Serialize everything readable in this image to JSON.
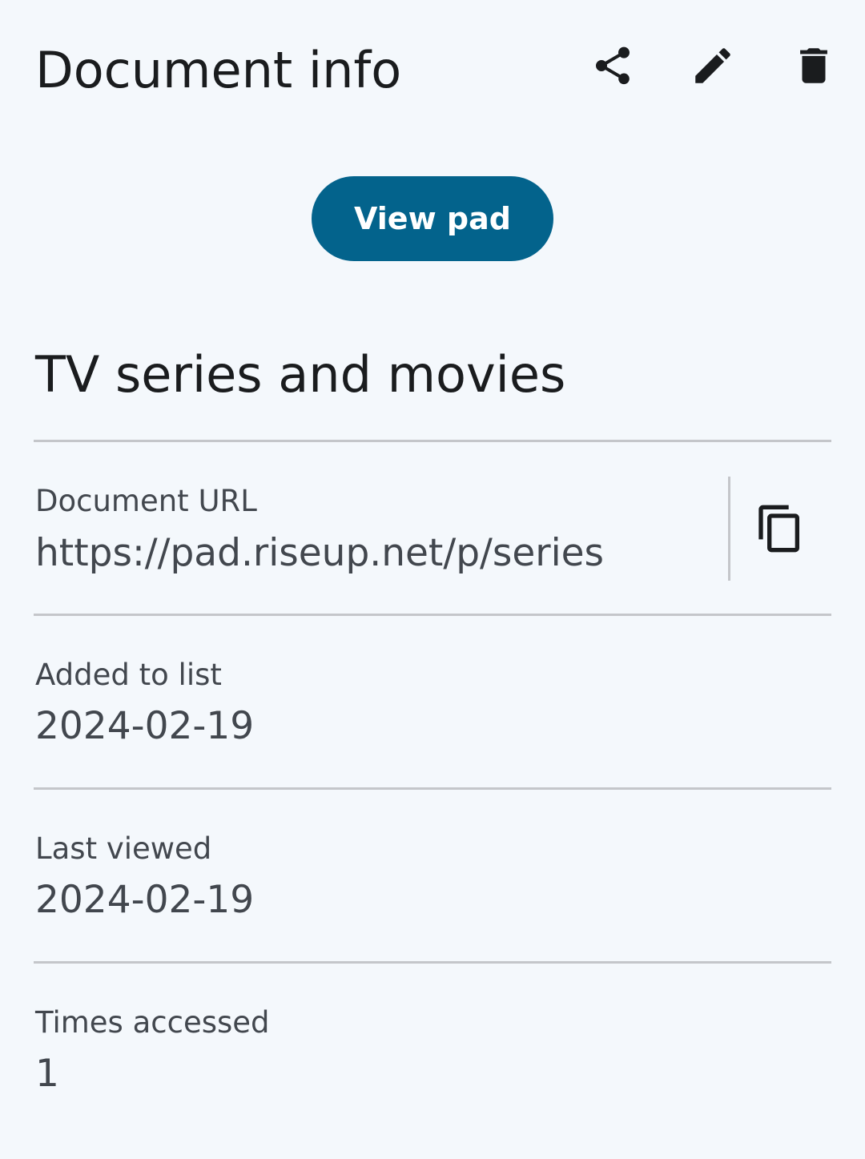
{
  "header": {
    "title": "Document info",
    "actions": [
      {
        "name": "share",
        "icon": "share-icon"
      },
      {
        "name": "edit",
        "icon": "pencil-icon"
      },
      {
        "name": "delete",
        "icon": "trash-icon"
      }
    ]
  },
  "view_button": {
    "label": "View pad"
  },
  "document": {
    "name": "TV series and movies",
    "url_label": "Document URL",
    "url": "https://pad.riseup.net/p/series",
    "copy_icon": "copy-icon",
    "added_label": "Added to list",
    "added": "2024-02-19",
    "viewed_label": "Last viewed",
    "viewed": "2024-02-19",
    "times_label": "Times accessed",
    "times": "1"
  },
  "colors": {
    "background": "#f4f8fc",
    "primary": "#03638c",
    "text": "#1a1c1e",
    "secondary_text": "#42474e",
    "divider": "#c4c6ca"
  }
}
